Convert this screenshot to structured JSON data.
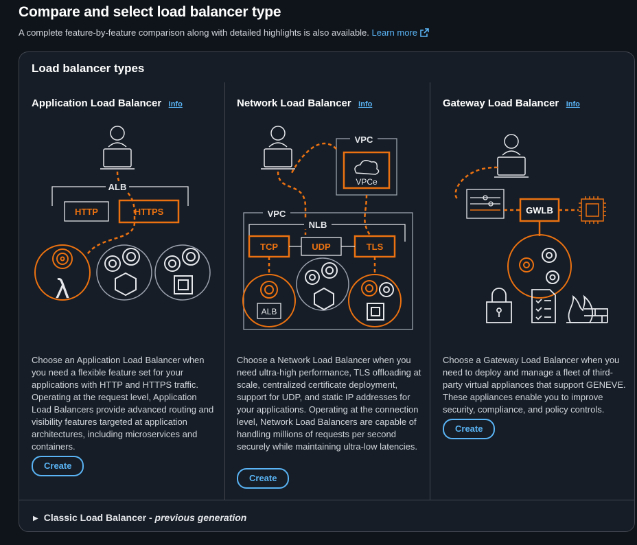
{
  "header": {
    "title": "Compare and select load balancer type",
    "subtitle": "A complete feature-by-feature comparison along with detailed highlights is also available.",
    "learn_more": "Learn more"
  },
  "panel": {
    "title": "Load balancer types",
    "info_label": "Info",
    "create_label": "Create",
    "alb": {
      "title": "Application Load Balancer",
      "description": "Choose an Application Load Balancer when you need a flexible feature set for your applications with HTTP and HTTPS traffic. Operating at the request level, Application Load Balancers provide advanced routing and visibility features targeted at application architectures, including microservices and containers.",
      "diagram": {
        "alb": "ALB",
        "http": "HTTP",
        "https": "HTTPS"
      }
    },
    "nlb": {
      "title": "Network Load Balancer",
      "description": "Choose a Network Load Balancer when you need ultra-high performance, TLS offloading at scale, centralized certificate deployment, support for UDP, and static IP addresses for your applications. Operating at the connection level, Network Load Balancers are capable of handling millions of requests per second securely while maintaining ultra-low latencies.",
      "diagram": {
        "vpc": "VPC",
        "vpce": "VPCe",
        "nlb": "NLB",
        "tcp": "TCP",
        "udp": "UDP",
        "tls": "TLS",
        "alb": "ALB"
      }
    },
    "glb": {
      "title": "Gateway Load Balancer",
      "description": "Choose a Gateway Load Balancer when you need to deploy and manage a fleet of third-party virtual appliances that support GENEVE. These appliances enable you to improve security, compliance, and policy controls.",
      "diagram": {
        "gwlb": "GWLB"
      }
    },
    "classic": {
      "label": "Classic Load Balancer - ",
      "sub": "previous generation"
    }
  },
  "colors": {
    "accent": "#ff9900",
    "link": "#5ab4f5",
    "line": "#ec7211"
  }
}
